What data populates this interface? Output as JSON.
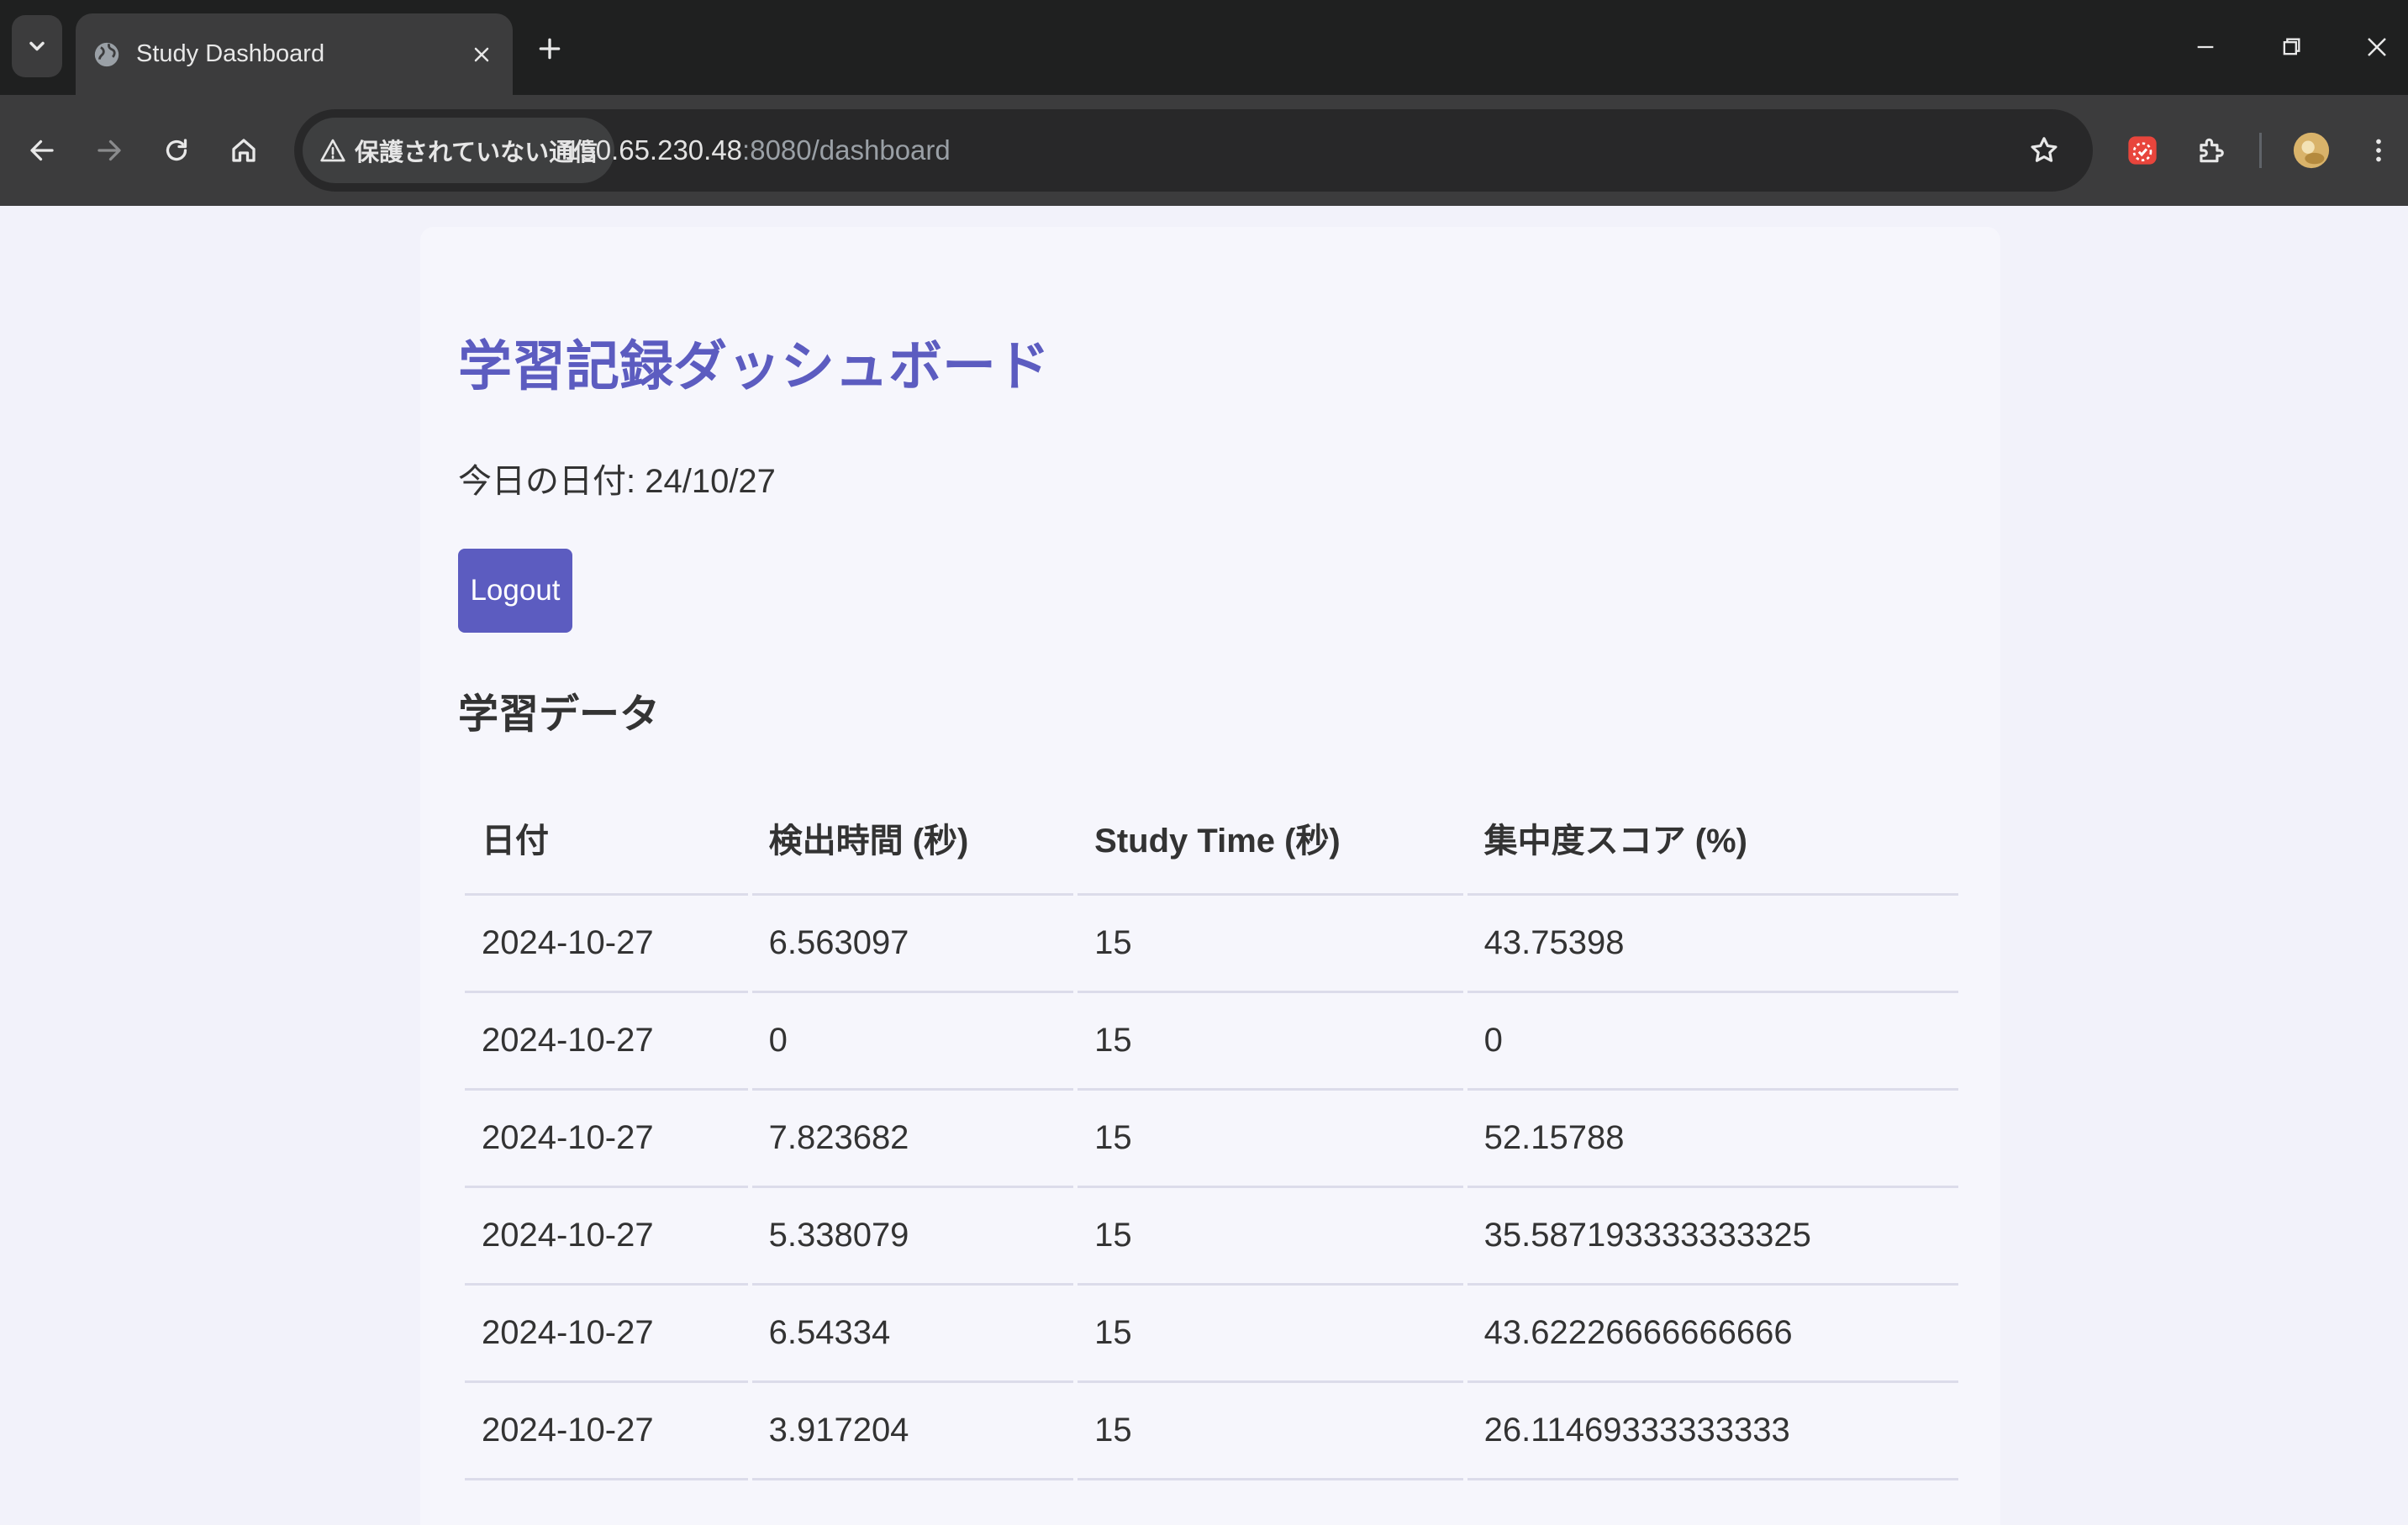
{
  "browser": {
    "tab_title": "Study Dashboard",
    "security_label": "保護されていない通信",
    "url_host": "150.65.230.48",
    "url_path": ":8080/dashboard"
  },
  "page": {
    "title": "学習記録ダッシュボード",
    "today_label": "今日の日付: 24/10/27",
    "logout_label": "Logout",
    "section_title": "学習データ"
  },
  "table": {
    "headers": [
      "日付",
      "検出時間 (秒)",
      "Study Time (秒)",
      "集中度スコア (%)"
    ],
    "rows": [
      [
        "2024-10-27",
        "6.563097",
        "15",
        "43.75398"
      ],
      [
        "2024-10-27",
        "0",
        "15",
        "0"
      ],
      [
        "2024-10-27",
        "7.823682",
        "15",
        "52.15788"
      ],
      [
        "2024-10-27",
        "5.338079",
        "15",
        "35.587193333333325"
      ],
      [
        "2024-10-27",
        "6.54334",
        "15",
        "43.62226666666666"
      ],
      [
        "2024-10-27",
        "3.917204",
        "15",
        "26.11469333333333"
      ]
    ]
  },
  "colors": {
    "accent": "#5c5cc0",
    "page_bg": "#f2f2fa",
    "chrome_dark": "#1f2020",
    "chrome_toolbar": "#3c3c3d"
  },
  "icons": [
    "tab-search-icon",
    "globe-icon",
    "close-icon",
    "plus-icon",
    "minimize-icon",
    "restore-icon",
    "back-icon",
    "forward-icon",
    "reload-icon",
    "home-icon",
    "warning-icon",
    "star-icon",
    "extension-icon",
    "puzzle-icon",
    "avatar"
  ]
}
